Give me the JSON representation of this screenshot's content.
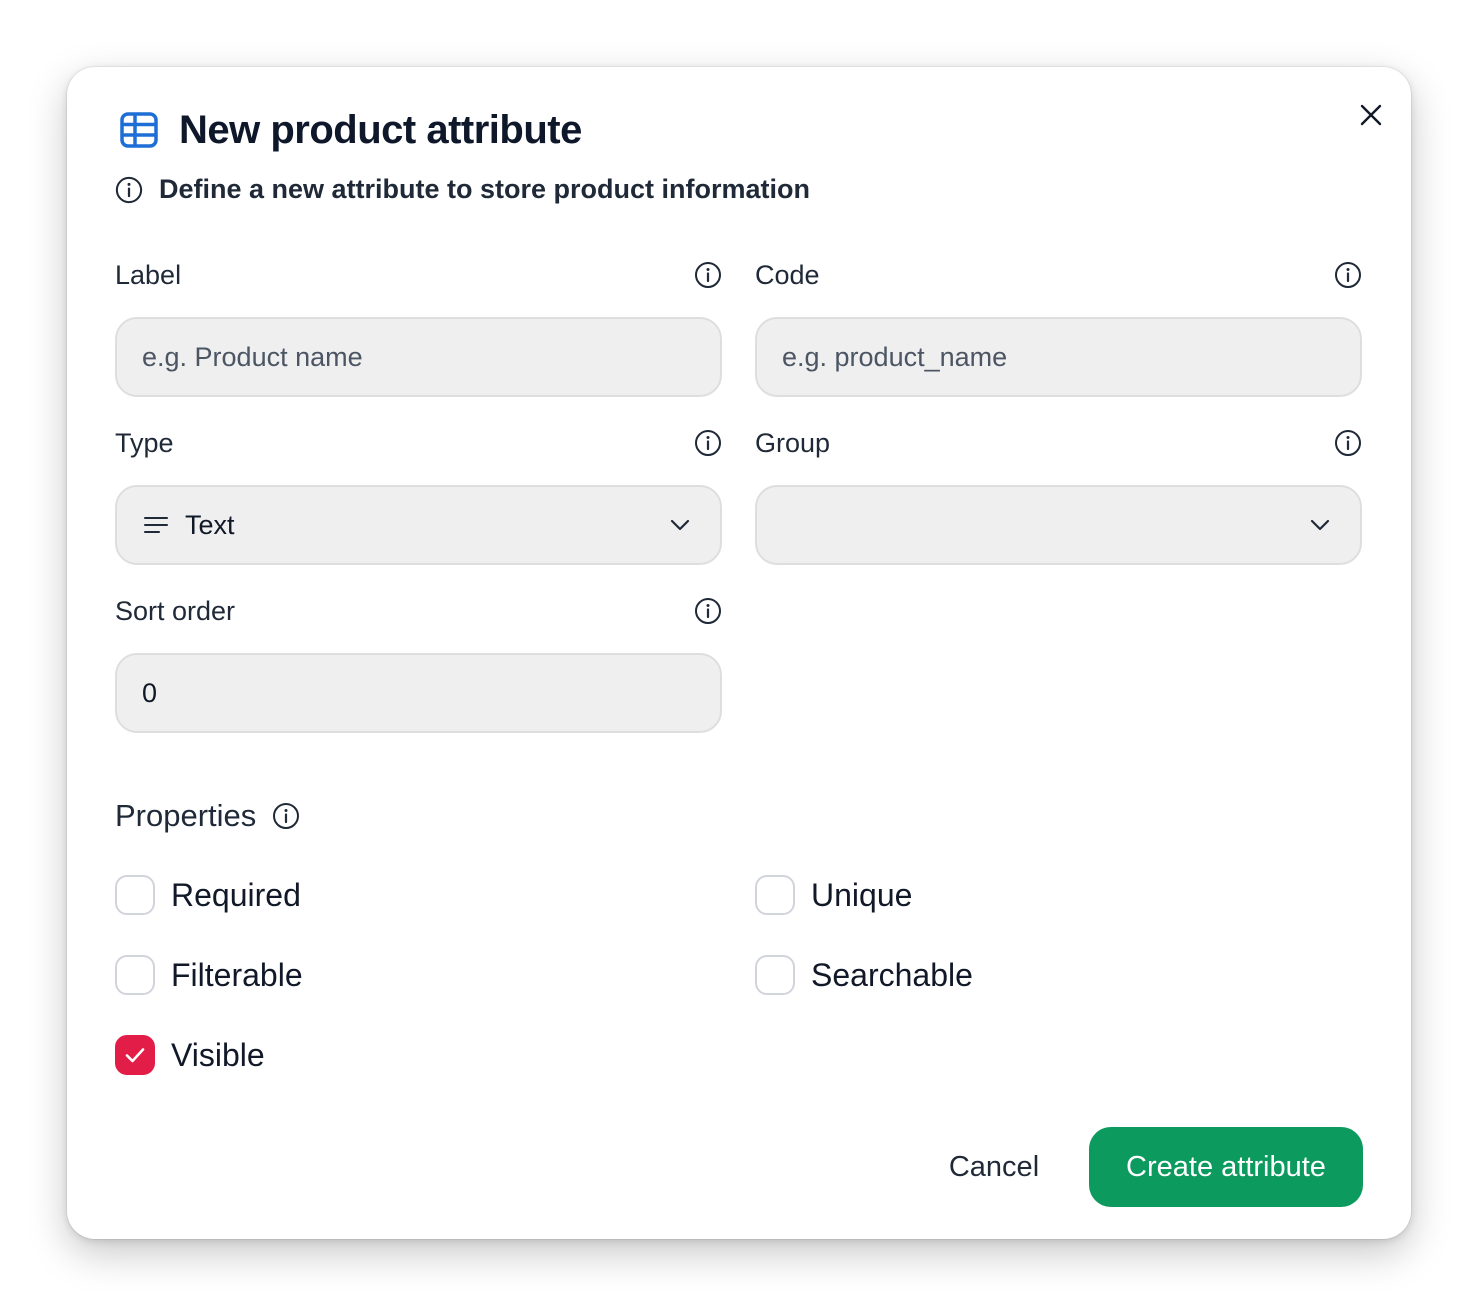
{
  "dialog": {
    "title": "New product attribute",
    "subtitle": "Define a new attribute to store product information",
    "icons": {
      "title": "table-icon",
      "subtitle": "info-icon",
      "close": "close-icon"
    }
  },
  "fields": {
    "label": {
      "label": "Label",
      "placeholder": "e.g. Product name",
      "value": ""
    },
    "code": {
      "label": "Code",
      "placeholder": "e.g. product_name",
      "value": ""
    },
    "type": {
      "label": "Type",
      "value": "Text",
      "icon": "text-lines-icon"
    },
    "group": {
      "label": "Group",
      "value": ""
    },
    "sort_order": {
      "label": "Sort order",
      "value": "0"
    }
  },
  "properties": {
    "title": "Properties",
    "options": [
      {
        "label": "Required",
        "checked": false
      },
      {
        "label": "Unique",
        "checked": false
      },
      {
        "label": "Filterable",
        "checked": false
      },
      {
        "label": "Searchable",
        "checked": false
      },
      {
        "label": "Visible",
        "checked": true
      }
    ]
  },
  "actions": {
    "cancel": "Cancel",
    "create": "Create attribute"
  },
  "colors": {
    "accent_icon": "#1d6fd6",
    "checkbox_checked": "#e11d48",
    "primary_button": "#0d9a5f"
  }
}
